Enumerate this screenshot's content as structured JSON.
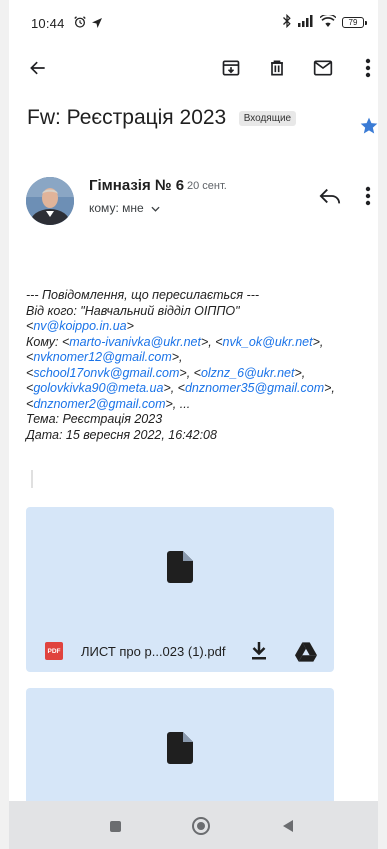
{
  "status_bar": {
    "time": "10:44",
    "battery": "79",
    "icons": [
      "alarm-icon",
      "navigation-icon",
      "bluetooth-icon",
      "signal-icon",
      "wifi-icon",
      "battery-icon"
    ]
  },
  "toolbar": {
    "icons": [
      "back-arrow-icon",
      "archive-icon",
      "delete-icon",
      "mark-unread-icon",
      "more-vert-icon"
    ]
  },
  "email": {
    "subject": "Fw: Реєстрація 2023",
    "label": "Входящие",
    "sender": {
      "name": "Гімназія № 6",
      "date": "20 сент.",
      "recipient": "кому: мне"
    },
    "body": {
      "line1": "--- Повідомлення, що пересилається ---",
      "line2": "Від кого: \"Навчальний відділ ОІППО\"",
      "from_email": "nv@koippo.in.ua",
      "to_label": "Кому: ",
      "emails": [
        "marto-ivanivka@ukr.net",
        "nvk_ok@ukr.net",
        "nvknomer12@gmail.com",
        "school17onvk@gmail.com",
        "olznz_6@ukr.net",
        "golovkivka90@meta.ua",
        "dnznomer35@gmail.com",
        "dnznomer2@gmail.com"
      ],
      "ellipsis": "...",
      "subject_line": "Тема: Реєстрація 2023",
      "date_line": "Дата: 15 вересня 2022, 16:42:08"
    },
    "attachments": [
      {
        "badge": "PDF",
        "filename": "ЛИСТ про р...023 (1).pdf"
      }
    ]
  },
  "colors": {
    "link": "#1a73e8",
    "star": "#3a7bd5",
    "attachment_bg": "#d6e6f8",
    "pdf_badge": "#e0433e"
  }
}
